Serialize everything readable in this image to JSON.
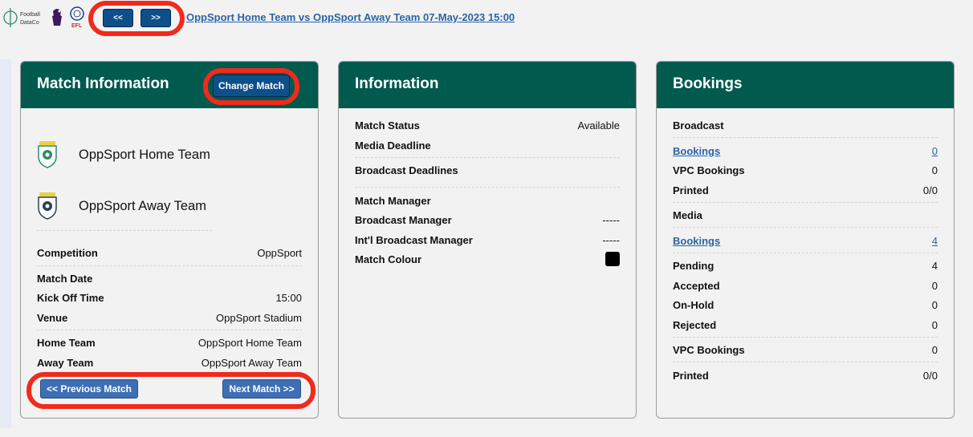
{
  "header": {
    "logos": [
      "football-datacoverage-logo",
      "premier-league-logo",
      "efl-logo"
    ],
    "fdc_logo_text": [
      "Football",
      "DataCo"
    ],
    "efl_logo_text": "EFL",
    "prev_label": "<<",
    "next_label": ">>",
    "match_title": "OppSport Home Team vs OppSport Away Team 07-May-2023 15:00"
  },
  "match_info": {
    "title": "Match Information",
    "change_match_label": "Change Match",
    "home_team": "OppSport Home Team",
    "away_team": "OppSport Away Team",
    "rows": [
      {
        "label": "Competition",
        "value": "OppSport"
      },
      {
        "label": "Match Date",
        "value": ""
      },
      {
        "label": "Kick Off Time",
        "value": "15:00"
      },
      {
        "label": "Venue",
        "value": "OppSport Stadium"
      },
      {
        "label": "Home Team",
        "value": "OppSport Home Team"
      },
      {
        "label": "Away Team",
        "value": "OppSport Away Team"
      }
    ],
    "previous_match_label": "<< Previous Match",
    "next_match_label": "Next Match >>"
  },
  "information": {
    "title": "Information",
    "rows": [
      {
        "label": "Match Status",
        "value": "Available"
      },
      {
        "label": "Media Deadline",
        "value": ""
      },
      {
        "label": "Broadcast Deadlines",
        "value": ""
      },
      {
        "label": "Match Manager",
        "value": ""
      },
      {
        "label": "Broadcast Manager",
        "value": "-----"
      },
      {
        "label": "Int'l Broadcast Manager",
        "value": "-----"
      },
      {
        "label": "Match Colour",
        "value": ""
      }
    ],
    "match_colour": "#000000"
  },
  "bookings": {
    "title": "Bookings",
    "broadcast_heading": "Broadcast",
    "broadcast_bookings_label": "Bookings",
    "broadcast_bookings_value": "0",
    "broadcast_vpc_label": "VPC Bookings",
    "broadcast_vpc_value": "0",
    "broadcast_printed_label": "Printed",
    "broadcast_printed_value": "0/0",
    "media_heading": "Media",
    "media_bookings_label": "Bookings",
    "media_bookings_value": "4",
    "pending_label": "Pending",
    "pending_value": "4",
    "accepted_label": "Accepted",
    "accepted_value": "0",
    "onhold_label": "On-Hold",
    "onhold_value": "0",
    "rejected_label": "Rejected",
    "rejected_value": "0",
    "media_vpc_label": "VPC Bookings",
    "media_vpc_value": "0",
    "media_printed_label": "Printed",
    "media_printed_value": "0/0"
  },
  "colors": {
    "header_green": "#005a4e",
    "button_blue": "#0d4f8a",
    "link_blue": "#2a63a8",
    "highlight_red": "#f02a1d"
  }
}
